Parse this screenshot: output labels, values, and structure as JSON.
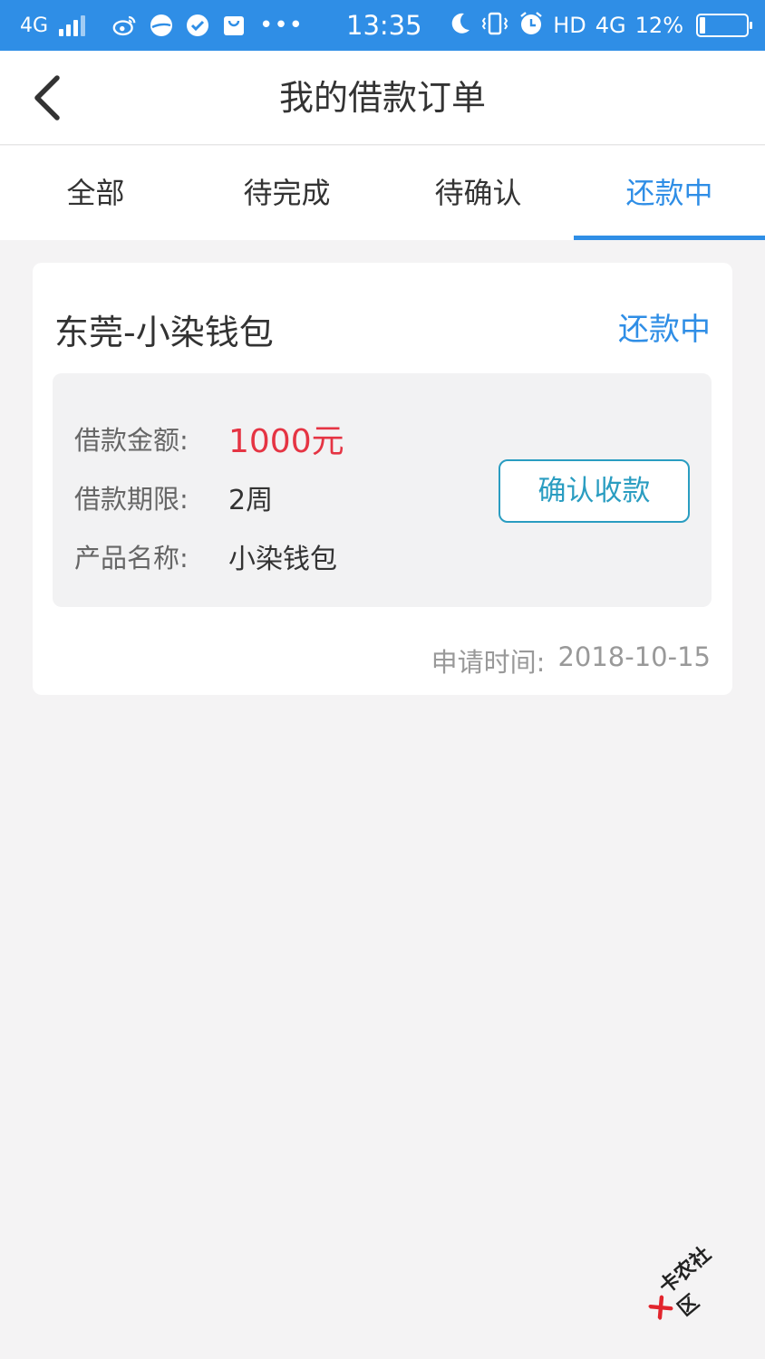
{
  "status_bar": {
    "carrier": "4G",
    "time": "13:35",
    "hd": "HD",
    "network": "4G",
    "battery": "12%",
    "battery_level": 0.12
  },
  "nav": {
    "title": "我的借款订单"
  },
  "tabs": [
    {
      "label": "全部"
    },
    {
      "label": "待完成"
    },
    {
      "label": "待确认"
    },
    {
      "label": "还款中",
      "active": true
    }
  ],
  "order": {
    "title": "东莞-小染钱包",
    "status": "还款中",
    "amount_label": "借款金额:",
    "amount": "1000元",
    "term_label": "借款期限:",
    "term": "2周",
    "product_label": "产品名称:",
    "product": "小染钱包",
    "confirm_button": "确认收款",
    "apply_time_label": "申请时间:",
    "apply_time": "2018-10-15"
  },
  "watermark": {
    "text": "卡农社区"
  },
  "colors": {
    "accent": "#2f8ee6",
    "button": "#2a9dc1",
    "amount": "#e53443"
  }
}
